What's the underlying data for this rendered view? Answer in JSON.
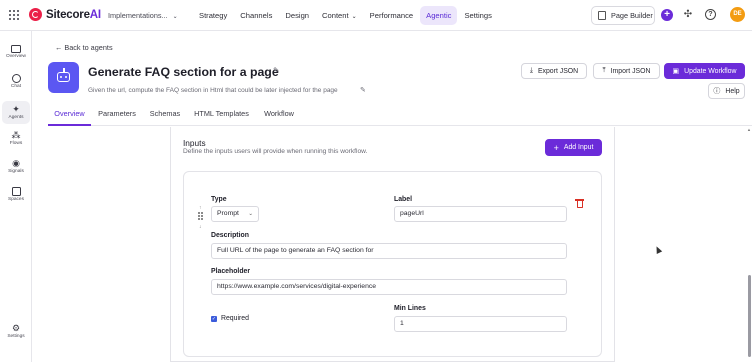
{
  "app": {
    "brand_main": "Sitecore",
    "brand_ai": "AI",
    "project": "Implementations...",
    "nav": [
      {
        "label": "Strategy"
      },
      {
        "label": "Channels"
      },
      {
        "label": "Design"
      },
      {
        "label": "Content"
      },
      {
        "label": "Performance"
      },
      {
        "label": "Agentic"
      },
      {
        "label": "Settings"
      }
    ],
    "active_nav": "Agentic",
    "page_builder_label": "Page Builder",
    "avatar_initials": "DE",
    "accent_color": "#6b2bd9"
  },
  "sidebar": {
    "items": [
      {
        "label": "Overview",
        "icon": "monitor-icon"
      },
      {
        "label": "Chat",
        "icon": "chat-icon"
      },
      {
        "label": "Agents",
        "icon": "sparkle-icon"
      },
      {
        "label": "Flows",
        "icon": "flows-icon"
      },
      {
        "label": "Signals",
        "icon": "signals-icon"
      },
      {
        "label": "Spaces",
        "icon": "spaces-icon"
      },
      {
        "label": "Settings",
        "icon": "gear-icon"
      }
    ],
    "active": "Agents"
  },
  "header": {
    "back_label": "← Back to agents",
    "title": "Generate FAQ section for a page",
    "subtitle": "Given the url, compute the FAQ section in Html that could be later injected for the page",
    "export_label": "Export JSON",
    "import_label": "Import JSON",
    "update_label": "Update Workflow",
    "help_label": "Help"
  },
  "tabs": [
    {
      "label": "Overview"
    },
    {
      "label": "Parameters"
    },
    {
      "label": "Schemas"
    },
    {
      "label": "HTML Templates"
    },
    {
      "label": "Workflow"
    }
  ],
  "active_tab": "Overview",
  "inputs": {
    "title": "Inputs",
    "description": "Define the inputs users will provide when running this workflow.",
    "add_label": "Add Input",
    "item": {
      "type_label": "Type",
      "type_value": "Prompt",
      "label_label": "Label",
      "label_value": "pageUrl",
      "description_label": "Description",
      "description_value": "Full URL of the page to generate an FAQ section for",
      "placeholder_label": "Placeholder",
      "placeholder_value": "https://www.example.com/services/digital-experience",
      "required_label": "Required",
      "required_checked": true,
      "min_lines_label": "Min Lines",
      "min_lines_value": "1"
    }
  }
}
